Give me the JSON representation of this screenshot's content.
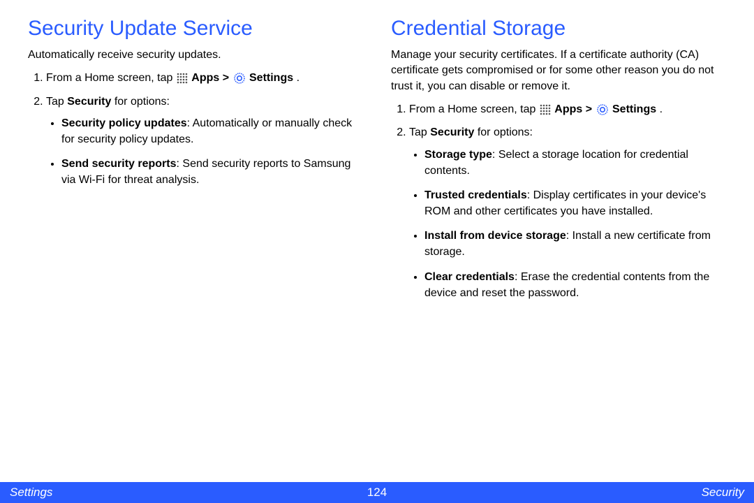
{
  "left": {
    "heading": "Security Update Service",
    "intro": "Automatically receive security updates.",
    "step1_prefix": "From a Home screen, tap ",
    "step1_apps": "Apps",
    "step1_gt": " > ",
    "step1_settings": "Settings",
    "step1_period": ".",
    "step2_prefix": "Tap ",
    "step2_bold": "Security",
    "step2_suffix": " for options:",
    "bullets": [
      {
        "title": "Security policy updates",
        "desc": ": Automatically or manually check for security policy updates."
      },
      {
        "title": "Send security reports",
        "desc": ": Send security reports to Samsung via Wi-Fi for threat analysis."
      }
    ]
  },
  "right": {
    "heading": "Credential Storage",
    "intro": "Manage your security certificates. If a certificate authority (CA) certificate gets compromised or for some other reason you do not trust it, you can disable or remove it.",
    "step1_prefix": "From a Home screen, tap ",
    "step1_apps": "Apps",
    "step1_gt": " > ",
    "step1_settings": "Settings",
    "step1_period": ".",
    "step2_prefix": "Tap ",
    "step2_bold": "Security",
    "step2_suffix": " for options:",
    "bullets": [
      {
        "title": "Storage type",
        "desc": ": Select a storage location for credential contents."
      },
      {
        "title": "Trusted credentials",
        "desc": ": Display certificates in your device's ROM and other certificates you have installed."
      },
      {
        "title": "Install from device storage",
        "desc": ": Install a new certificate from storage."
      },
      {
        "title": "Clear credentials",
        "desc": ": Erase the credential contents from the device and reset the password."
      }
    ]
  },
  "footer": {
    "left": "Settings",
    "center": "124",
    "right": "Security"
  }
}
